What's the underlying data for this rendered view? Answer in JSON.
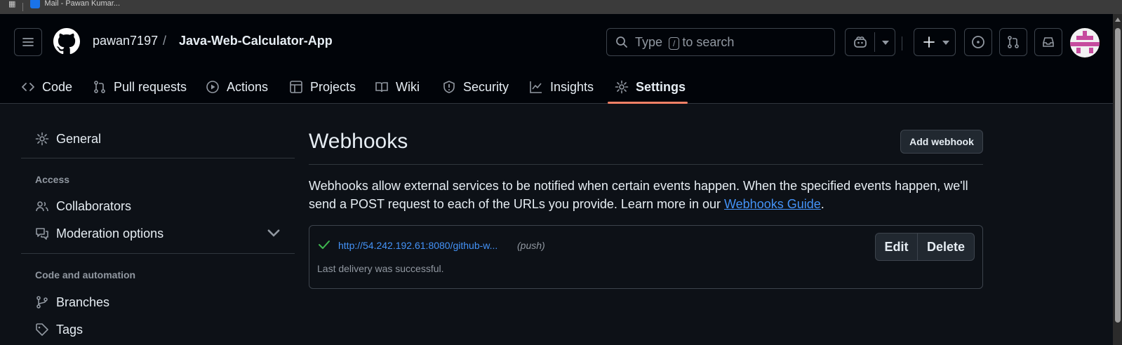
{
  "browser": {
    "bookmark_label": "Mail - Pawan Kumar..."
  },
  "header": {
    "owner": "pawan7197",
    "separator": "/",
    "repo": "Java-Web-Calculator-App",
    "search": {
      "prefix": "Type",
      "key": "/",
      "suffix": "to search"
    }
  },
  "tabs": [
    {
      "label": "Code",
      "icon": "code-icon"
    },
    {
      "label": "Pull requests",
      "icon": "pull-request-icon"
    },
    {
      "label": "Actions",
      "icon": "play-icon"
    },
    {
      "label": "Projects",
      "icon": "table-icon"
    },
    {
      "label": "Wiki",
      "icon": "book-icon"
    },
    {
      "label": "Security",
      "icon": "shield-icon"
    },
    {
      "label": "Insights",
      "icon": "graph-icon"
    },
    {
      "label": "Settings",
      "icon": "gear-icon",
      "selected": true
    }
  ],
  "sidebar": {
    "general": "General",
    "access_heading": "Access",
    "collaborators": "Collaborators",
    "moderation": "Moderation options",
    "code_heading": "Code and automation",
    "branches": "Branches",
    "tags": "Tags"
  },
  "main": {
    "title": "Webhooks",
    "add_button": "Add webhook",
    "description": "Webhooks allow external services to be notified when certain events happen. When the specified events happen, we'll send a POST request to each of the URLs you provide. Learn more in our ",
    "guide_link": "Webhooks Guide",
    "description_end": ".",
    "webhook": {
      "url": "http://54.242.192.61:8080/github-w...",
      "event": "(push)",
      "status": "Last delivery was successful.",
      "edit": "Edit",
      "delete": "Delete"
    }
  },
  "colors": {
    "background": "#0d1117",
    "header_bg": "#010409",
    "accent_underline": "#f78166",
    "link": "#4493f8",
    "success": "#3fb950"
  }
}
